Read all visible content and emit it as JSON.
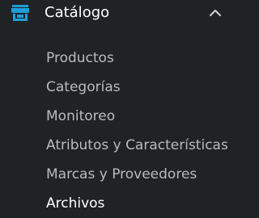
{
  "menu": {
    "icon": "store-icon",
    "accent_color": "#1e9dd8",
    "label": "Catálogo",
    "expanded": true,
    "chevron_icon": "chevron-up-icon",
    "items": [
      {
        "label": "Productos",
        "active": false
      },
      {
        "label": "Categorías",
        "active": false
      },
      {
        "label": "Monitoreo",
        "active": false
      },
      {
        "label": "Atributos y Características",
        "active": false
      },
      {
        "label": "Marcas y Proveedores",
        "active": false
      },
      {
        "label": "Archivos",
        "active": true
      }
    ]
  }
}
